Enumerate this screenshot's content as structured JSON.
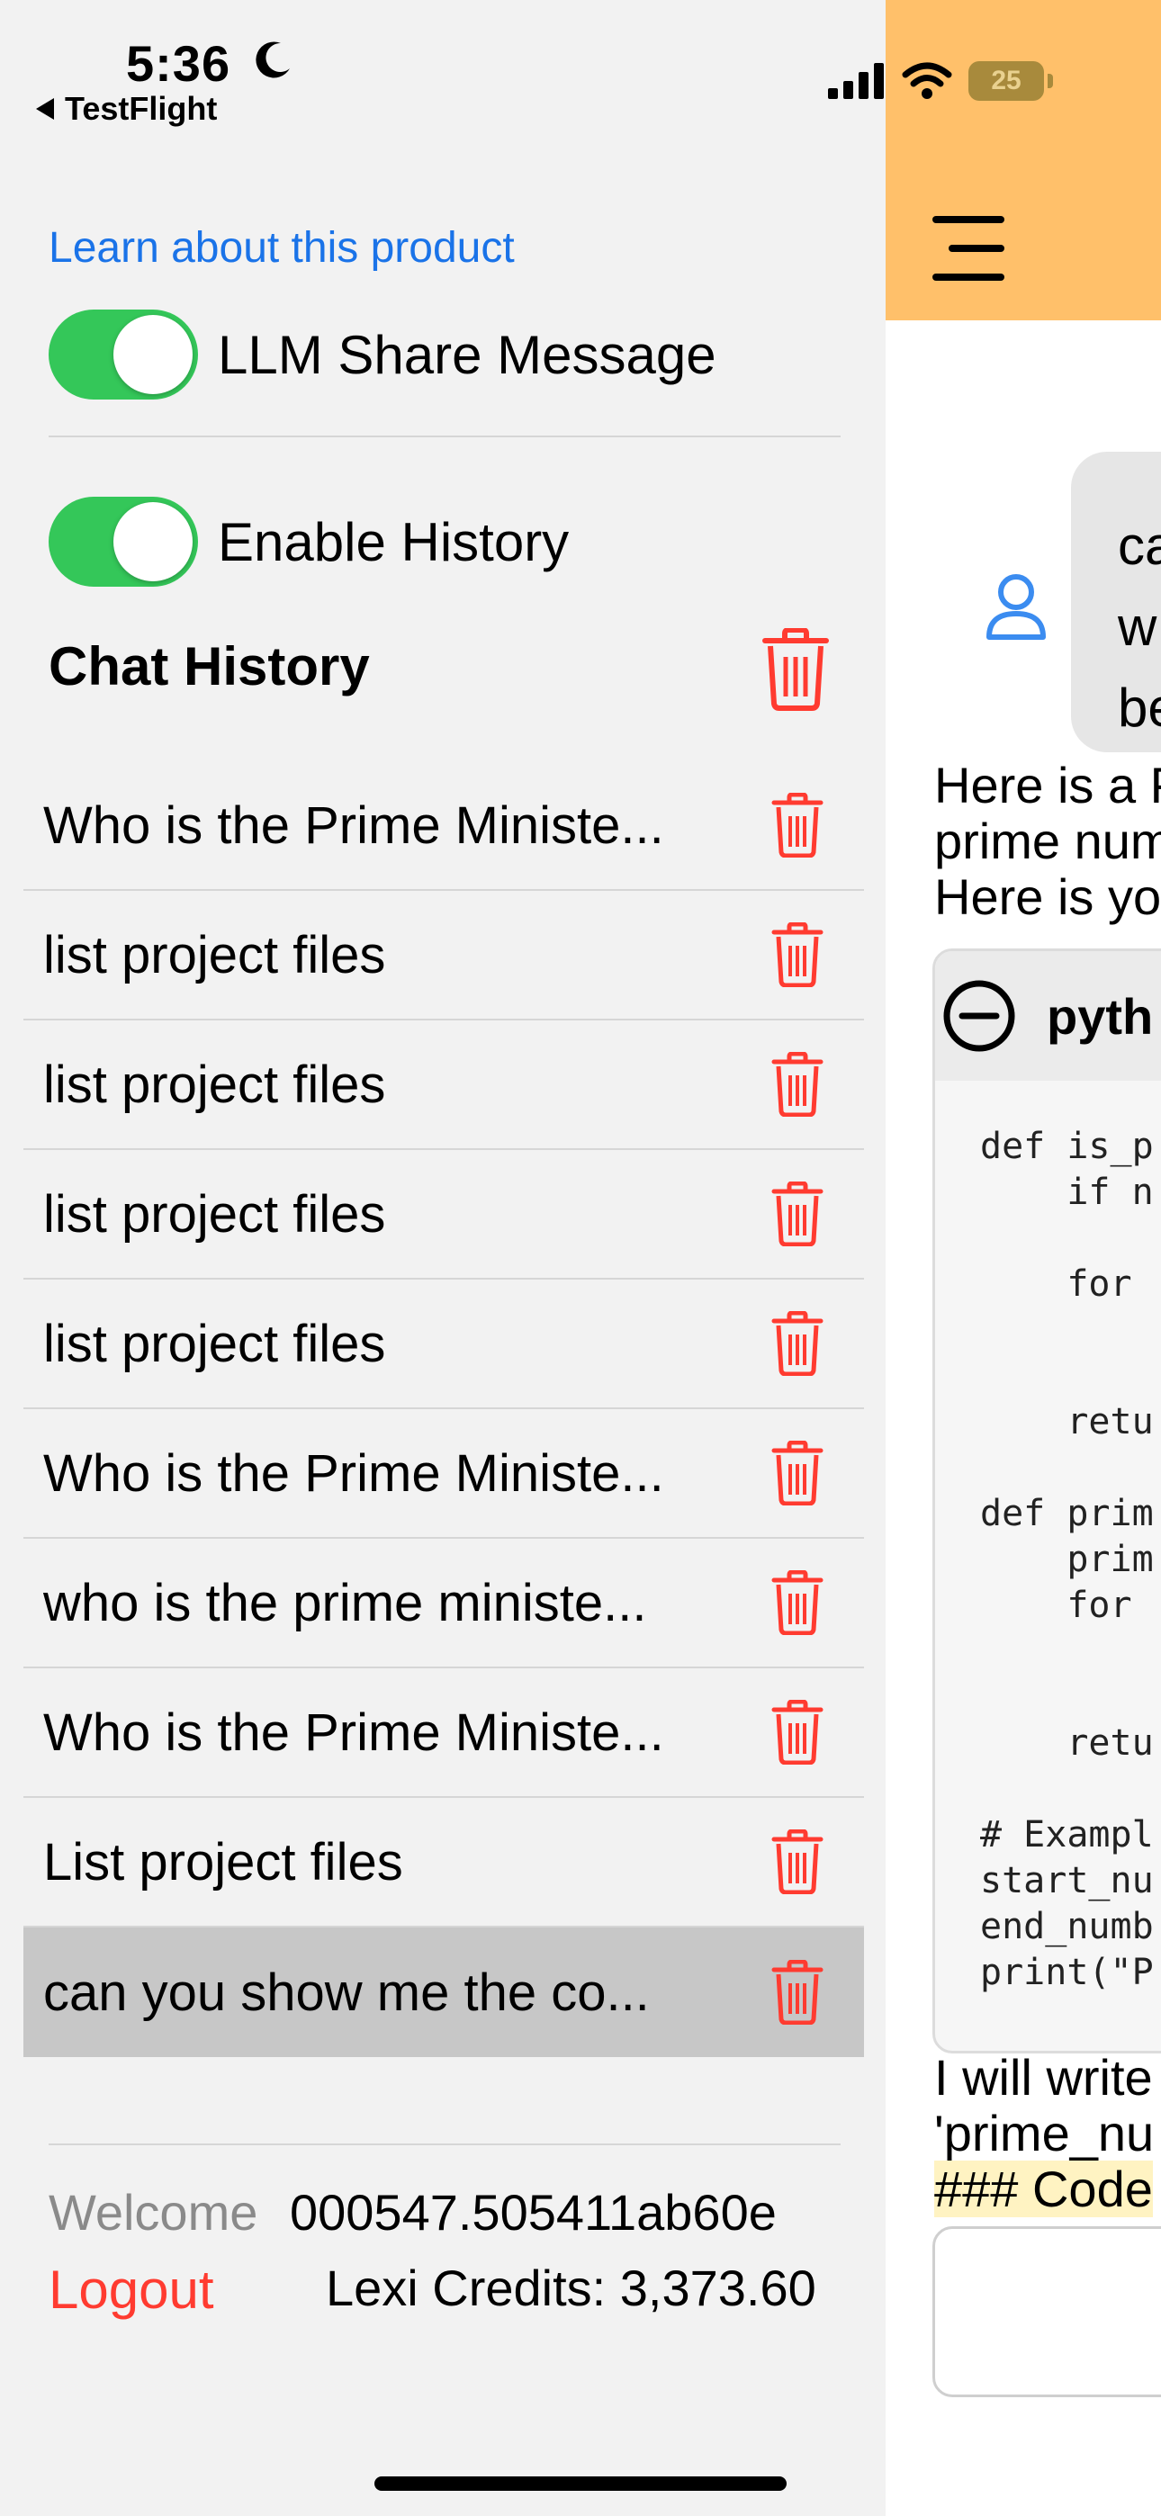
{
  "status_bar": {
    "time": "5:36",
    "back_app": "TestFlight",
    "battery": "25",
    "icons": [
      "moon-icon",
      "signal-icon",
      "wifi-icon",
      "battery-icon"
    ]
  },
  "drawer": {
    "learn_link": "Learn about this product",
    "toggles": [
      {
        "label": "LLM Share Message",
        "on": true
      },
      {
        "label": "Enable History",
        "on": true
      }
    ],
    "history_title": "Chat History",
    "history": [
      "Who is the Prime Ministe...",
      "list project files",
      "list project files",
      "list project files",
      "list project files",
      "Who is the Prime Ministe...",
      "who is the prime ministe...",
      "Who is the Prime Ministe...",
      "List project files",
      "can you show me the co..."
    ],
    "selected_index": 9,
    "welcome_label": "Welcome",
    "user_id": "000547.505411ab60e",
    "logout_label": "Logout",
    "credits": "Lexi Credits: 3,373.60"
  },
  "chat": {
    "header_color": "#ffc06a",
    "user_message_lines": [
      "ca",
      "w",
      "be"
    ],
    "reply_lines": [
      "Here is a P",
      "prime num",
      "Here is you"
    ],
    "code_lang": "pyth",
    "code_lines": [
      "def is_p",
      "    if n",
      "",
      "    for ",
      "",
      "",
      "    retu",
      "",
      "def prim",
      "    prim",
      "    for ",
      "",
      "",
      "    retu",
      "",
      "# Exampl",
      "start_nu",
      "end_numb",
      "print(\"P"
    ],
    "after_lines": [
      "I will write",
      "'prime_nu"
    ],
    "after_highlight": "### Code "
  },
  "colors": {
    "toggle_on": "#34c759",
    "link": "#1a73e8",
    "danger": "#ff3b30",
    "drawer_bg": "#f2f2f2",
    "selected_row": "#c7c7c7"
  }
}
